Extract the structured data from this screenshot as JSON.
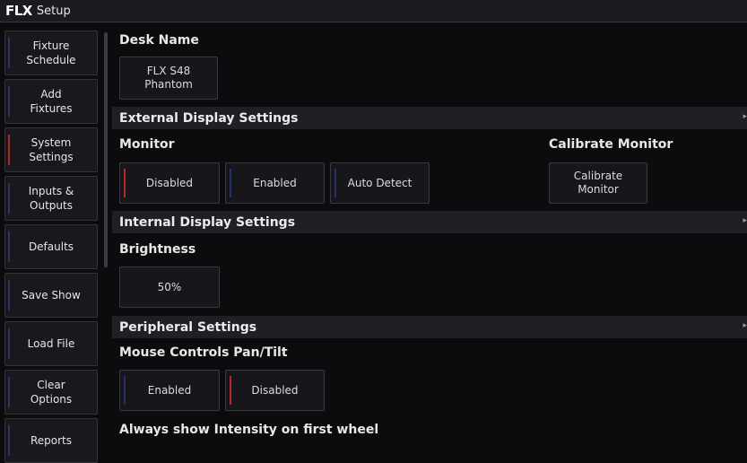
{
  "titlebar": {
    "brand": "FLX",
    "title": "Setup"
  },
  "sidebar": {
    "items": [
      {
        "label": "Fixture\nSchedule",
        "active": false
      },
      {
        "label": "Add\nFixtures",
        "active": false
      },
      {
        "label": "System\nSettings",
        "active": true
      },
      {
        "label": "Inputs &\nOutputs",
        "active": false
      },
      {
        "label": "Defaults",
        "active": false
      },
      {
        "label": "Save Show",
        "active": false
      },
      {
        "label": "Load File",
        "active": false
      },
      {
        "label": "Clear\nOptions",
        "active": false
      },
      {
        "label": "Reports",
        "active": false
      }
    ]
  },
  "desk": {
    "heading": "Desk Name",
    "value": "FLX S48\nPhantom"
  },
  "external": {
    "section": "External Display Settings",
    "monitor_heading": "Monitor",
    "options": [
      "Disabled",
      "Enabled",
      "Auto Detect"
    ],
    "selected": "Disabled",
    "calibrate_heading": "Calibrate Monitor",
    "calibrate_button": "Calibrate\nMonitor"
  },
  "internal": {
    "section": "Internal Display Settings",
    "brightness_heading": "Brightness",
    "brightness_value": "50%"
  },
  "peripheral": {
    "section": "Peripheral Settings",
    "mouse_heading": "Mouse Controls Pan/Tilt",
    "options": [
      "Enabled",
      "Disabled"
    ],
    "selected": "Disabled",
    "intensity_heading": "Always show Intensity on first wheel"
  },
  "icons": {
    "expand": "expand-arrow-icon"
  },
  "colors": {
    "selected_mark": "#b4282a",
    "unselected_mark": "#26306a",
    "background": "#0c0c0e"
  }
}
